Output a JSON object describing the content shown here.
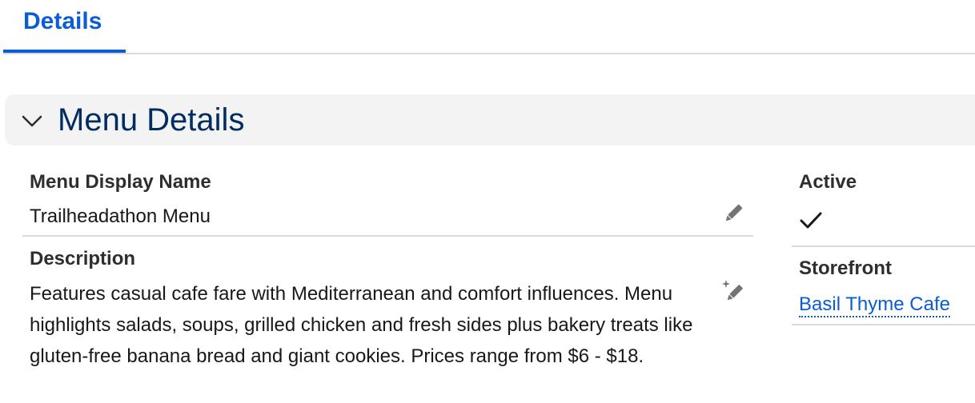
{
  "tabs": [
    {
      "label": "Details",
      "active": true
    }
  ],
  "section": {
    "title": "Menu Details",
    "icon": "chevron-down-icon"
  },
  "fields": {
    "menu_display_name": {
      "label": "Menu Display Name",
      "value": "Trailheadathon Menu",
      "icon": "pencil-icon"
    },
    "description": {
      "label": "Description",
      "value": "Features casual cafe fare with Mediterranean and comfort influences. Menu highlights salads, soups, grilled chicken and fresh sides plus bakery treats like gluten-free banana bread and giant cookies. Prices range from $6 - $18.",
      "icon": "sparkle-pencil-icon"
    },
    "active": {
      "label": "Active",
      "checked": true,
      "icon": "checkmark-icon"
    },
    "storefront": {
      "label": "Storefront",
      "value": "Basil Thyme Cafe"
    }
  },
  "colors": {
    "accent": "#0b5cd5",
    "section_title": "#032d60",
    "section_bg": "#f3f3f3",
    "divider": "#dddbda"
  }
}
